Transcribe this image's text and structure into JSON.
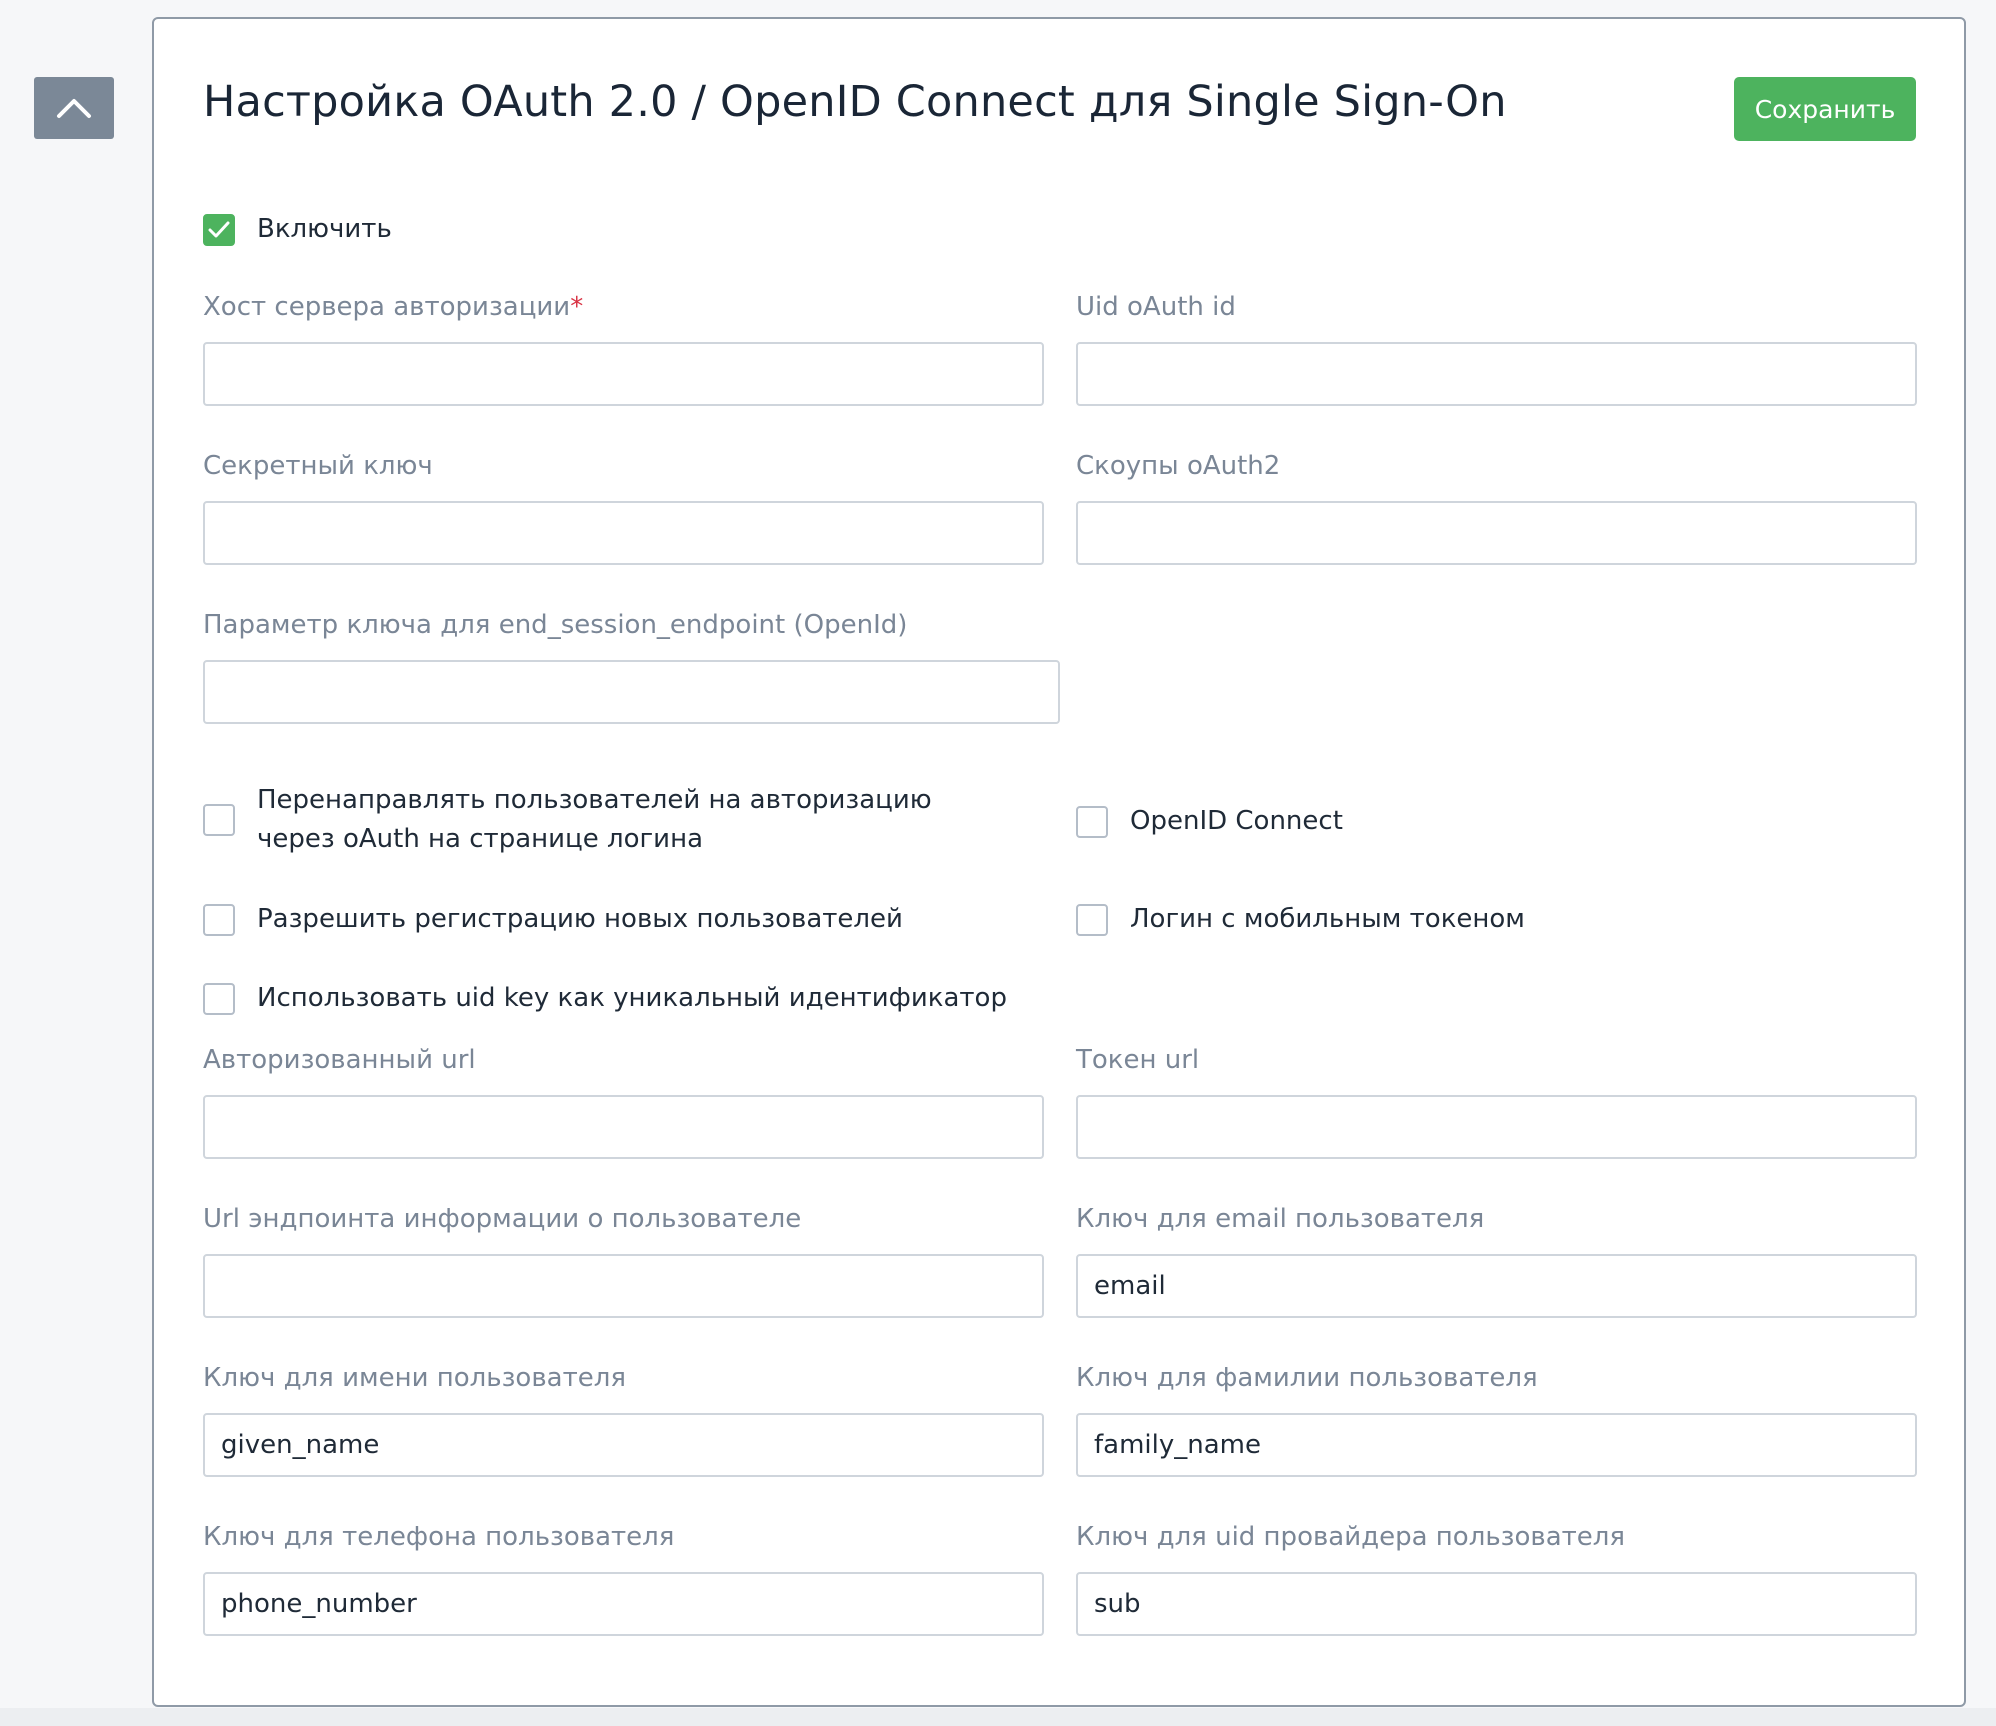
{
  "header": {
    "title": "Настройка OAuth 2.0 / OpenID Connect для Single Sign-On",
    "save_label": "Сохранить"
  },
  "enable": {
    "label": "Включить",
    "checked": true
  },
  "fields": {
    "auth_host": {
      "label": "Хост сервера авторизации",
      "required_mark": "*",
      "value": ""
    },
    "uid_oauth_id": {
      "label": "Uid oAuth id",
      "value": ""
    },
    "secret_key": {
      "label": "Секретный ключ",
      "value": ""
    },
    "scopes": {
      "label": "Скоупы oAuth2",
      "value": ""
    },
    "end_session_param": {
      "label": "Параметр ключа для end_session_endpoint (OpenId)",
      "value": ""
    },
    "authorized_url": {
      "label": "Авторизованный url",
      "value": ""
    },
    "token_url": {
      "label": "Токен url",
      "value": ""
    },
    "userinfo_url": {
      "label": "Url эндпоинта информации о пользователе",
      "value": ""
    },
    "email_key": {
      "label": "Ключ для email пользователя",
      "value": "email"
    },
    "first_name_key": {
      "label": "Ключ для имени пользователя",
      "value": "given_name"
    },
    "last_name_key": {
      "label": "Ключ для фамилии пользователя",
      "value": "family_name"
    },
    "phone_key": {
      "label": "Ключ для телефона пользователя",
      "value": "phone_number"
    },
    "provider_uid_key": {
      "label": "Ключ для uid провайдера пользователя",
      "value": "sub"
    }
  },
  "options": {
    "redirect_login": {
      "label": "Перенаправлять пользователей на авторизацию через oAuth на странице логина",
      "checked": false
    },
    "openid_connect": {
      "label": "OpenID Connect",
      "checked": false
    },
    "allow_registration": {
      "label": "Разрешить регистрацию новых пользователей",
      "checked": false
    },
    "mobile_token_login": {
      "label": "Логин с мобильным токеном",
      "checked": false
    },
    "use_uid_key": {
      "label": "Использовать uid key как уникальный идентификатор",
      "checked": false
    }
  },
  "icons": {
    "scroll_top": "chevron-up-icon",
    "check": "checkmark-icon"
  },
  "colors": {
    "accent_green": "#4db35e",
    "required_red": "#d93344",
    "label_gray": "#7a8696"
  }
}
